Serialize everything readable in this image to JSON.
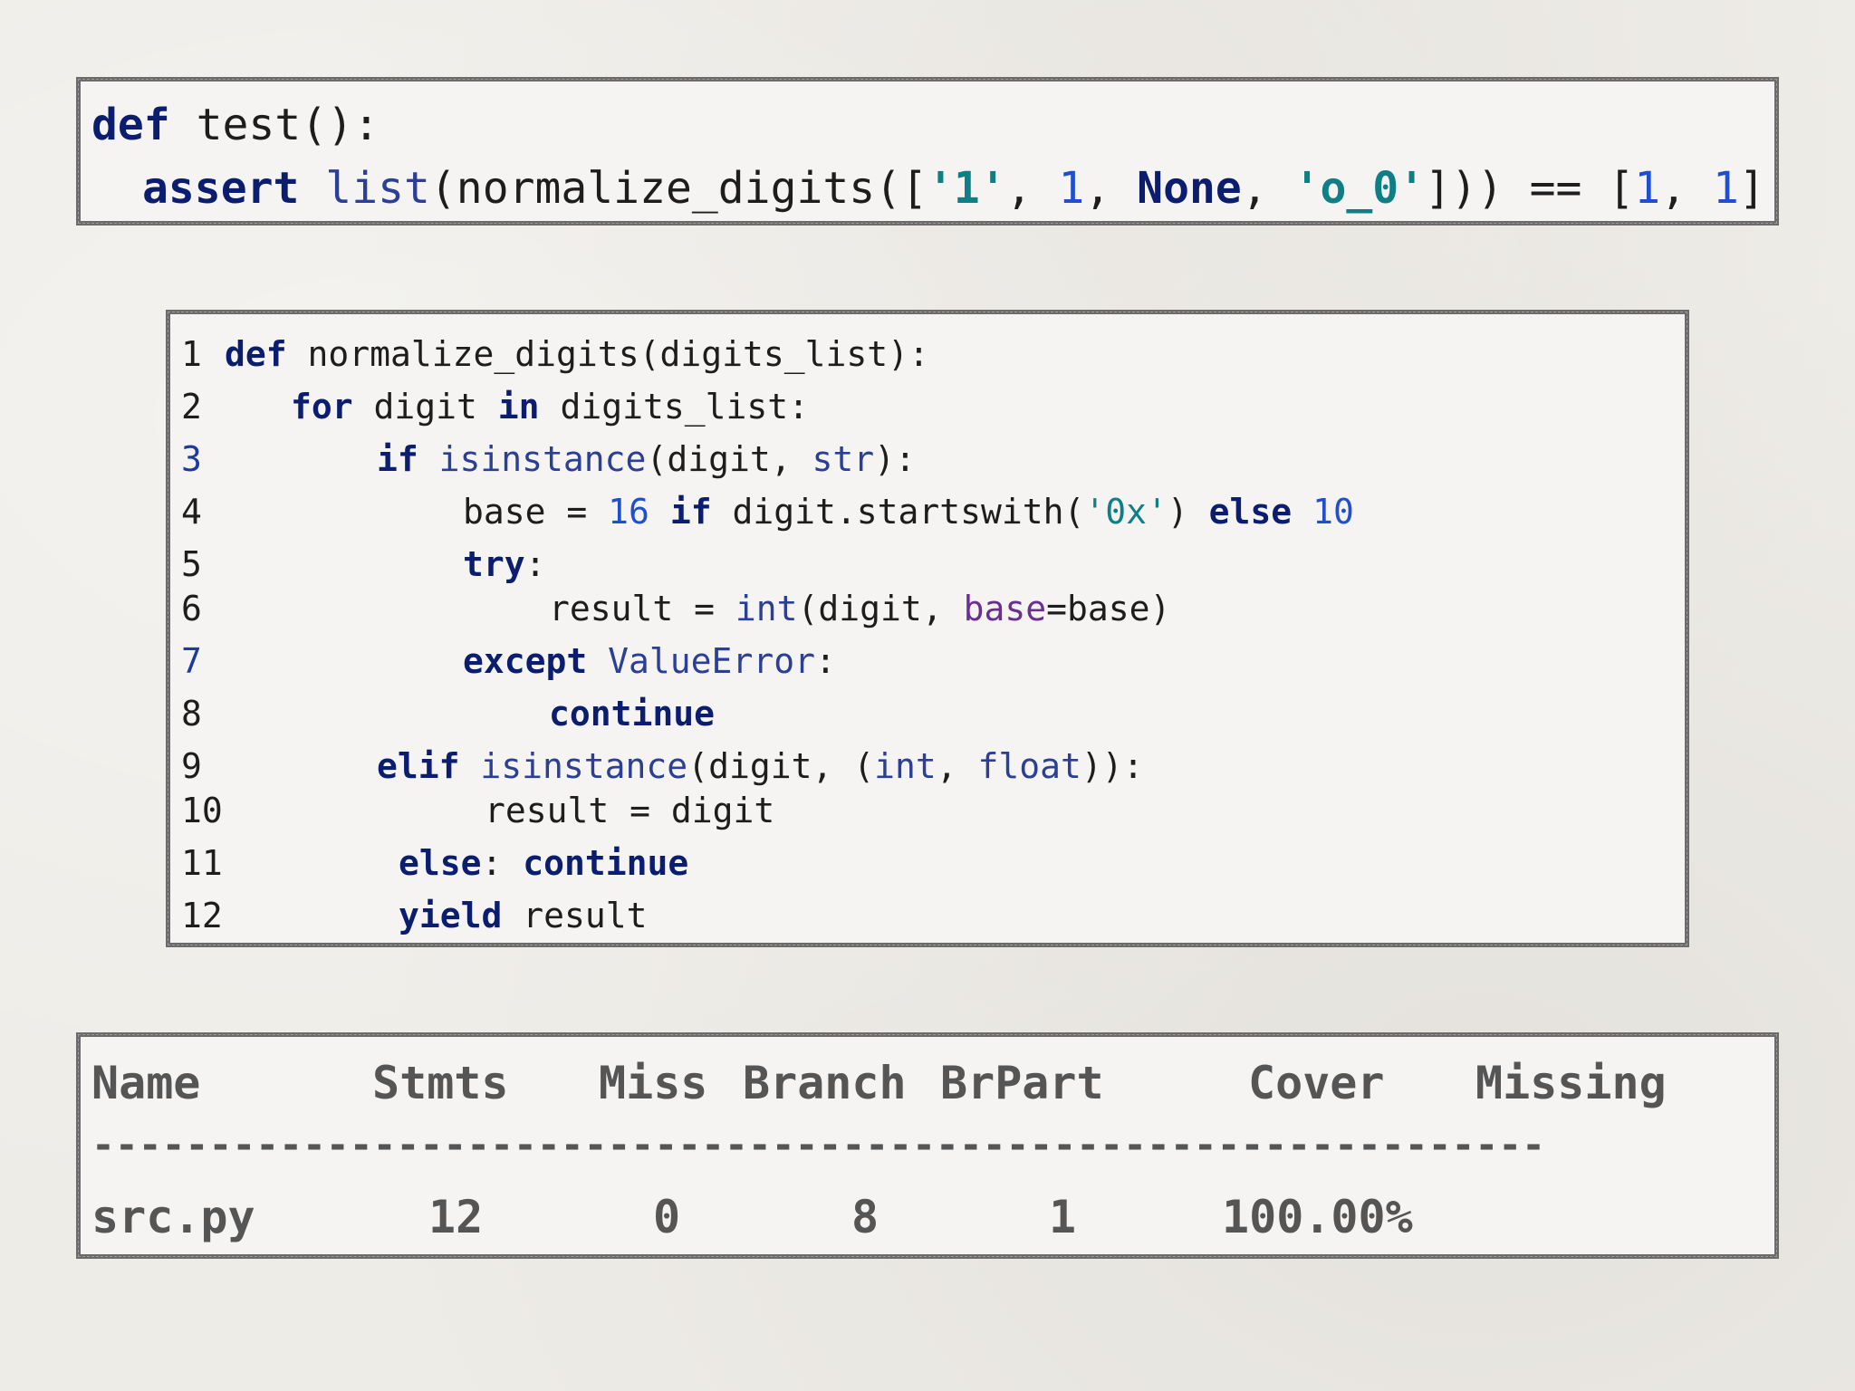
{
  "test_snippet": {
    "line1": {
      "kw": "def",
      "rest": " test():"
    },
    "line2": {
      "kw_assert": "assert",
      "fn_list": "list",
      "open": "(normalize_digits([",
      "s1": "'1'",
      "c1": ", ",
      "n1": "1",
      "c2": ", ",
      "none": "None",
      "c3": ", ",
      "s2": "'o_0'",
      "close": "])) == [",
      "r1": "1",
      "c4": ", ",
      "r2": "1",
      "end": "]"
    }
  },
  "code_listing": {
    "line_numbers": [
      "1",
      "2",
      "3",
      "4",
      "5",
      "6",
      "7",
      "8",
      "9",
      "10",
      "11",
      "12"
    ],
    "l1": {
      "kw": "def",
      "rest": " normalize_digits(digits_list):"
    },
    "l2": {
      "kw1": "for",
      "mid": " digit ",
      "kw2": "in",
      "rest": " digits_list:"
    },
    "l3": {
      "kw": "if",
      "sp": " ",
      "fn": "isinstance",
      "mid": "(digit, ",
      "cls": "str",
      "end": "):"
    },
    "l4": {
      "a": "base = ",
      "n1": "16",
      "sp": " ",
      "kw1": "if",
      "b": " digit.startswith(",
      "s": "'0x'",
      "c": ") ",
      "kw2": "else",
      "sp2": " ",
      "n2": "10"
    },
    "l5": {
      "kw": "try",
      "end": ":"
    },
    "l6": {
      "a": "result = ",
      "fn": "int",
      "b": "(digit, ",
      "kw": "base",
      "c": "=base)"
    },
    "l7": {
      "kw": "except",
      "sp": " ",
      "cls": "ValueError",
      "end": ":"
    },
    "l8": {
      "kw": "continue"
    },
    "l9": {
      "kw": "elif",
      "sp": " ",
      "fn": "isinstance",
      "a": "(digit, (",
      "c1": "int",
      "b": ", ",
      "c2": "float",
      "end": ")):"
    },
    "l10": {
      "text": "result = digit"
    },
    "l11": {
      "kw1": "else",
      "mid": ": ",
      "kw2": "continue"
    },
    "l12": {
      "kw": "yield",
      "rest": " result"
    }
  },
  "coverage": {
    "headers": [
      "Name",
      "Stmts",
      "Miss",
      "Branch",
      "BrPart",
      "Cover",
      "Missing"
    ],
    "separator": "--------------------------------------------------------------",
    "row": {
      "name": "src.py",
      "stmts": "12",
      "miss": "0",
      "branch": "8",
      "brpart": "1",
      "cover": "100.00%",
      "missing": ""
    }
  },
  "colors": {
    "keyword": "#0b1d6e",
    "builtin": "#2b3f95",
    "number": "#1f4fcf",
    "string": "#0f7f86",
    "kwarg": "#6b2f8f",
    "table_text": "#555555",
    "border": "#6b6b6b"
  }
}
